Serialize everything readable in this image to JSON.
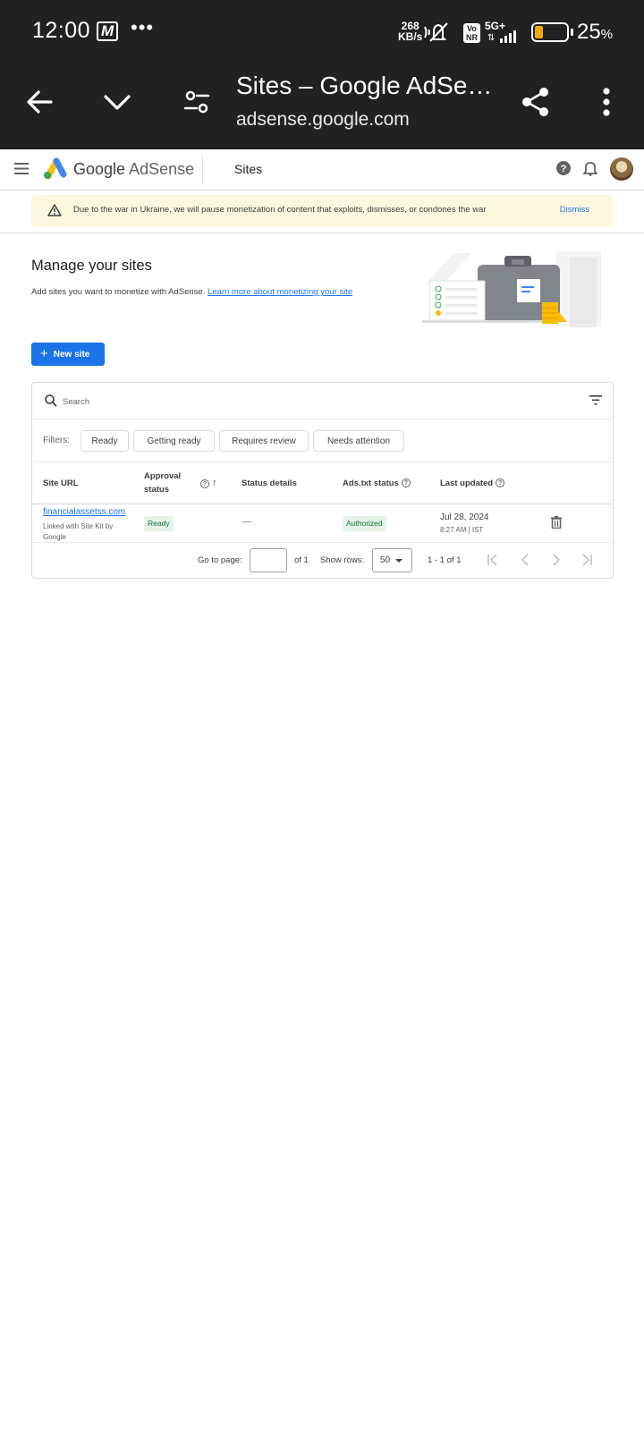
{
  "status_bar": {
    "time": "12:00",
    "carrier_badge": "M",
    "more_dots": "•••",
    "net_speed_value": "268",
    "net_speed_unit": "KB/s",
    "volte_top": "Vo",
    "volte_bottom": "NR",
    "network": "5G+",
    "battery_percent": "25",
    "battery_percent_sign": "%",
    "battery_level": 0.25,
    "battery_color": "#f2a900"
  },
  "browser": {
    "page_title": "Sites – Google AdSe…",
    "url": "adsense.google.com",
    "icons": [
      "back-arrow-icon",
      "chevron-down-icon",
      "page-settings-icon",
      "share-icon",
      "more-vert-icon"
    ]
  },
  "app_header": {
    "brand_google": "Google",
    "brand_product": "AdSense",
    "section": "Sites",
    "icons": [
      "menu-icon",
      "adsense-logo-icon",
      "help-icon",
      "bell-icon",
      "avatar"
    ]
  },
  "banner": {
    "message": "Due to the war in Ukraine, we will pause monetization of content that exploits, dismisses, or condones the war",
    "dismiss_label": "Dismiss",
    "background": "#fef7e0"
  },
  "main": {
    "title": "Manage your sites",
    "subtitle_text": "Add sites you want to monetize with AdSense. ",
    "subtitle_link": "Learn more about monetizing your site",
    "new_site_label": "New site",
    "new_site_plus": "+",
    "accent": "#1a73e8"
  },
  "table": {
    "search_placeholder": "Search",
    "filters_label": "Filters:",
    "filter_chips": [
      "Ready",
      "Getting ready",
      "Requires review",
      "Needs attention"
    ],
    "columns": {
      "site_url": "Site URL",
      "approval_status_1": "Approval",
      "approval_status_2": "status",
      "status_details": "Status details",
      "ads_txt_status": "Ads.txt status",
      "last_updated": "Last updated"
    },
    "help_glyph": "?",
    "sort_glyph": "↑",
    "rows": [
      {
        "site": "financialassetss.com",
        "site_sub": "Linked with Site Kit by Google",
        "approval": "Ready",
        "status_details": "—",
        "ads_txt": "Authorized",
        "updated_date": "Jul 28, 2024",
        "updated_time": "8:27 AM | IST"
      }
    ],
    "pagination": {
      "go_to_page": "Go to page:",
      "page_input_value": "",
      "of_pages": "of 1",
      "show_rows": "Show rows:",
      "rows_per_page": "50",
      "range": "1 - 1 of 1"
    }
  }
}
